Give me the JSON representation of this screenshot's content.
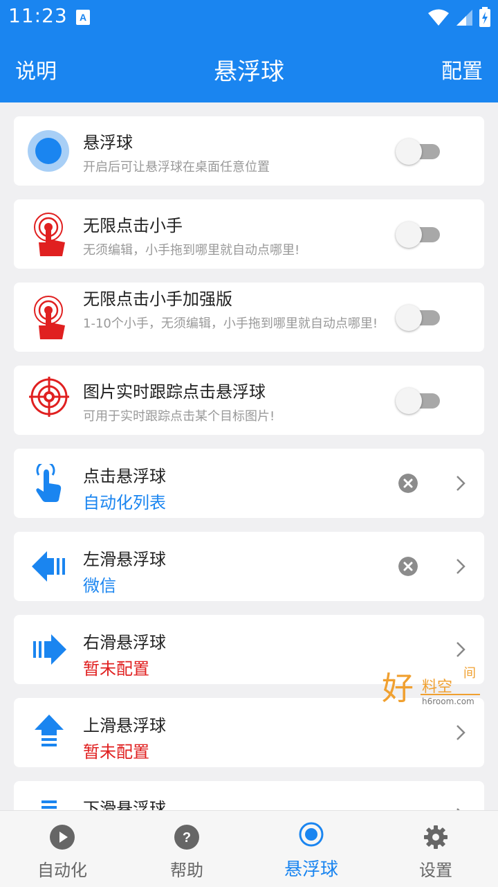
{
  "status_bar": {
    "time": "11:23"
  },
  "app_bar": {
    "left_action": "说明",
    "title": "悬浮球",
    "right_action": "配置"
  },
  "toggle_items": [
    {
      "title": "悬浮球",
      "description": "开启后可让悬浮球在桌面任意位置",
      "enabled": false,
      "icon": "floating-ball-icon"
    },
    {
      "title": "无限点击小手",
      "description": "无须编辑，小手拖到哪里就自动点哪里!",
      "enabled": false,
      "icon": "tap-hand-icon"
    },
    {
      "title": "无限点击小手加强版",
      "description": "1-10个小手，无须编辑，小手拖到哪里就自动点哪里!",
      "enabled": false,
      "icon": "tap-hand-plus-icon"
    },
    {
      "title": "图片实时跟踪点击悬浮球",
      "description": "可用于实时跟踪点击某个目标图片!",
      "enabled": false,
      "icon": "target-icon"
    }
  ],
  "gesture_items": [
    {
      "title": "点击悬浮球",
      "value": "自动化列表",
      "value_color": "blue",
      "clearable": true,
      "icon": "pointer-hand-icon"
    },
    {
      "title": "左滑悬浮球",
      "value": "微信",
      "value_color": "blue",
      "clearable": true,
      "icon": "arrow-left-icon"
    },
    {
      "title": "右滑悬浮球",
      "value": "暂未配置",
      "value_color": "red",
      "clearable": false,
      "icon": "arrow-right-icon"
    },
    {
      "title": "上滑悬浮球",
      "value": "暂未配置",
      "value_color": "red",
      "clearable": false,
      "icon": "arrow-up-icon"
    },
    {
      "title": "下滑悬浮球",
      "value": "",
      "value_color": "red",
      "clearable": false,
      "icon": "arrow-down-icon"
    }
  ],
  "watermark": {
    "text_main": "好",
    "text_sub": "料空",
    "text_corner": "间",
    "url": "h6room.com"
  },
  "bottom_nav": [
    {
      "label": "自动化",
      "icon": "play-circle-icon",
      "active": false
    },
    {
      "label": "帮助",
      "icon": "help-circle-icon",
      "active": false
    },
    {
      "label": "悬浮球",
      "icon": "floating-ball-nav-icon",
      "active": true
    },
    {
      "label": "设置",
      "icon": "gear-icon",
      "active": false
    }
  ],
  "colors": {
    "primary": "#1a85f0",
    "accent_red": "#e02020",
    "background": "#f0f0f2"
  }
}
